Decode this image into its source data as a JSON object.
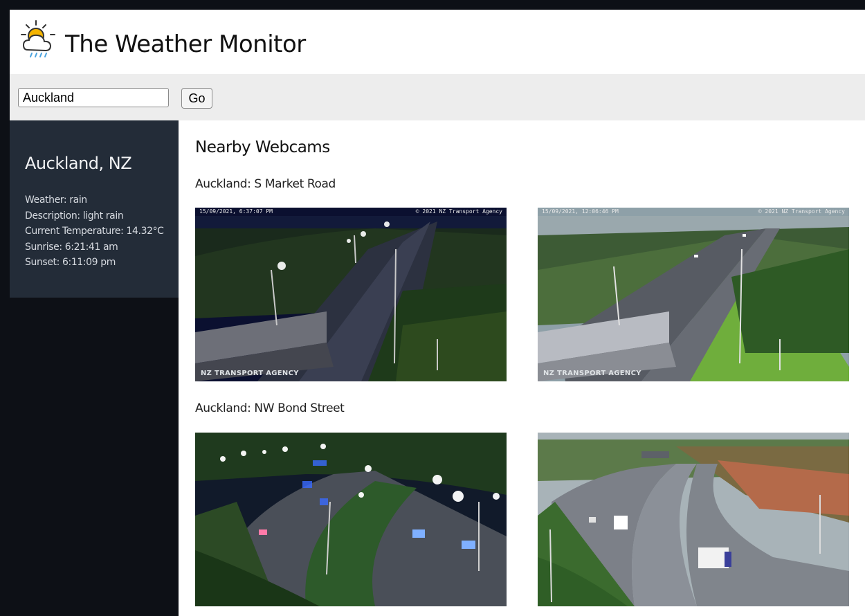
{
  "app": {
    "title": "The Weather Monitor",
    "logo_icon": "sun-cloud-rain-icon"
  },
  "search": {
    "value": "Auckland",
    "button_label": "Go"
  },
  "sidebar": {
    "city": "Auckland, NZ",
    "stats": [
      {
        "label": "Weather:",
        "value": "rain"
      },
      {
        "label": "Description:",
        "value": "light rain"
      },
      {
        "label": "Current Temperature:",
        "value": "14.32°C"
      },
      {
        "label": "Sunrise:",
        "value": "6:21:41 am"
      },
      {
        "label": "Sunset:",
        "value": "6:11:09 pm"
      }
    ]
  },
  "main": {
    "section_title": "Nearby Webcams",
    "webcams": [
      {
        "name": "Auckland: S Market Road",
        "images": [
          {
            "timestamp": "15/09/2021, 6:37:07 PM",
            "copyright": "© 2021 NZ Transport Agency",
            "watermark": "NZ TRANSPORT AGENCY",
            "scene": "night"
          },
          {
            "timestamp": "15/09/2021, 12:06:46 PM",
            "copyright": "© 2021 NZ Transport Agency",
            "watermark": "NZ TRANSPORT AGENCY",
            "scene": "day"
          }
        ]
      },
      {
        "name": "Auckland: NW Bond Street",
        "images": [
          {
            "scene": "night"
          },
          {
            "scene": "day"
          }
        ]
      }
    ]
  },
  "colors": {
    "sidebar_card": "#232c38",
    "sidebar_bg": "#0d1016",
    "search_bar": "#ededed",
    "logo_sun": "#f4b400",
    "logo_rain": "#4aa3df"
  }
}
